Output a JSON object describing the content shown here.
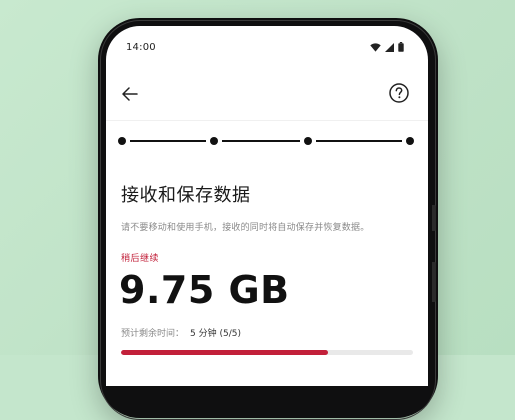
{
  "status_bar": {
    "time": "14:00",
    "icons": [
      "wifi-icon",
      "cellular-signal-icon",
      "battery-icon"
    ]
  },
  "topbar": {
    "back_icon": "arrow-left-icon",
    "help_icon": "question-circle-icon"
  },
  "stepper": {
    "steps": 4,
    "current_step": 4
  },
  "main": {
    "title": "接收和保存数据",
    "subtitle": "请不要移动和使用手机，接收的同时将自动保存并恢复数据。",
    "continue_later": "稍后继续",
    "data_size": "9.75 GB",
    "time_remaining_label": "预计剩余时间：",
    "time_remaining_value": "5 分钟 (5/5)",
    "progress": 0.71
  },
  "colors": {
    "accent": "#c2203a",
    "background": "#c4e6cc",
    "text_primary": "#111111",
    "text_secondary": "#8a8a8a"
  }
}
